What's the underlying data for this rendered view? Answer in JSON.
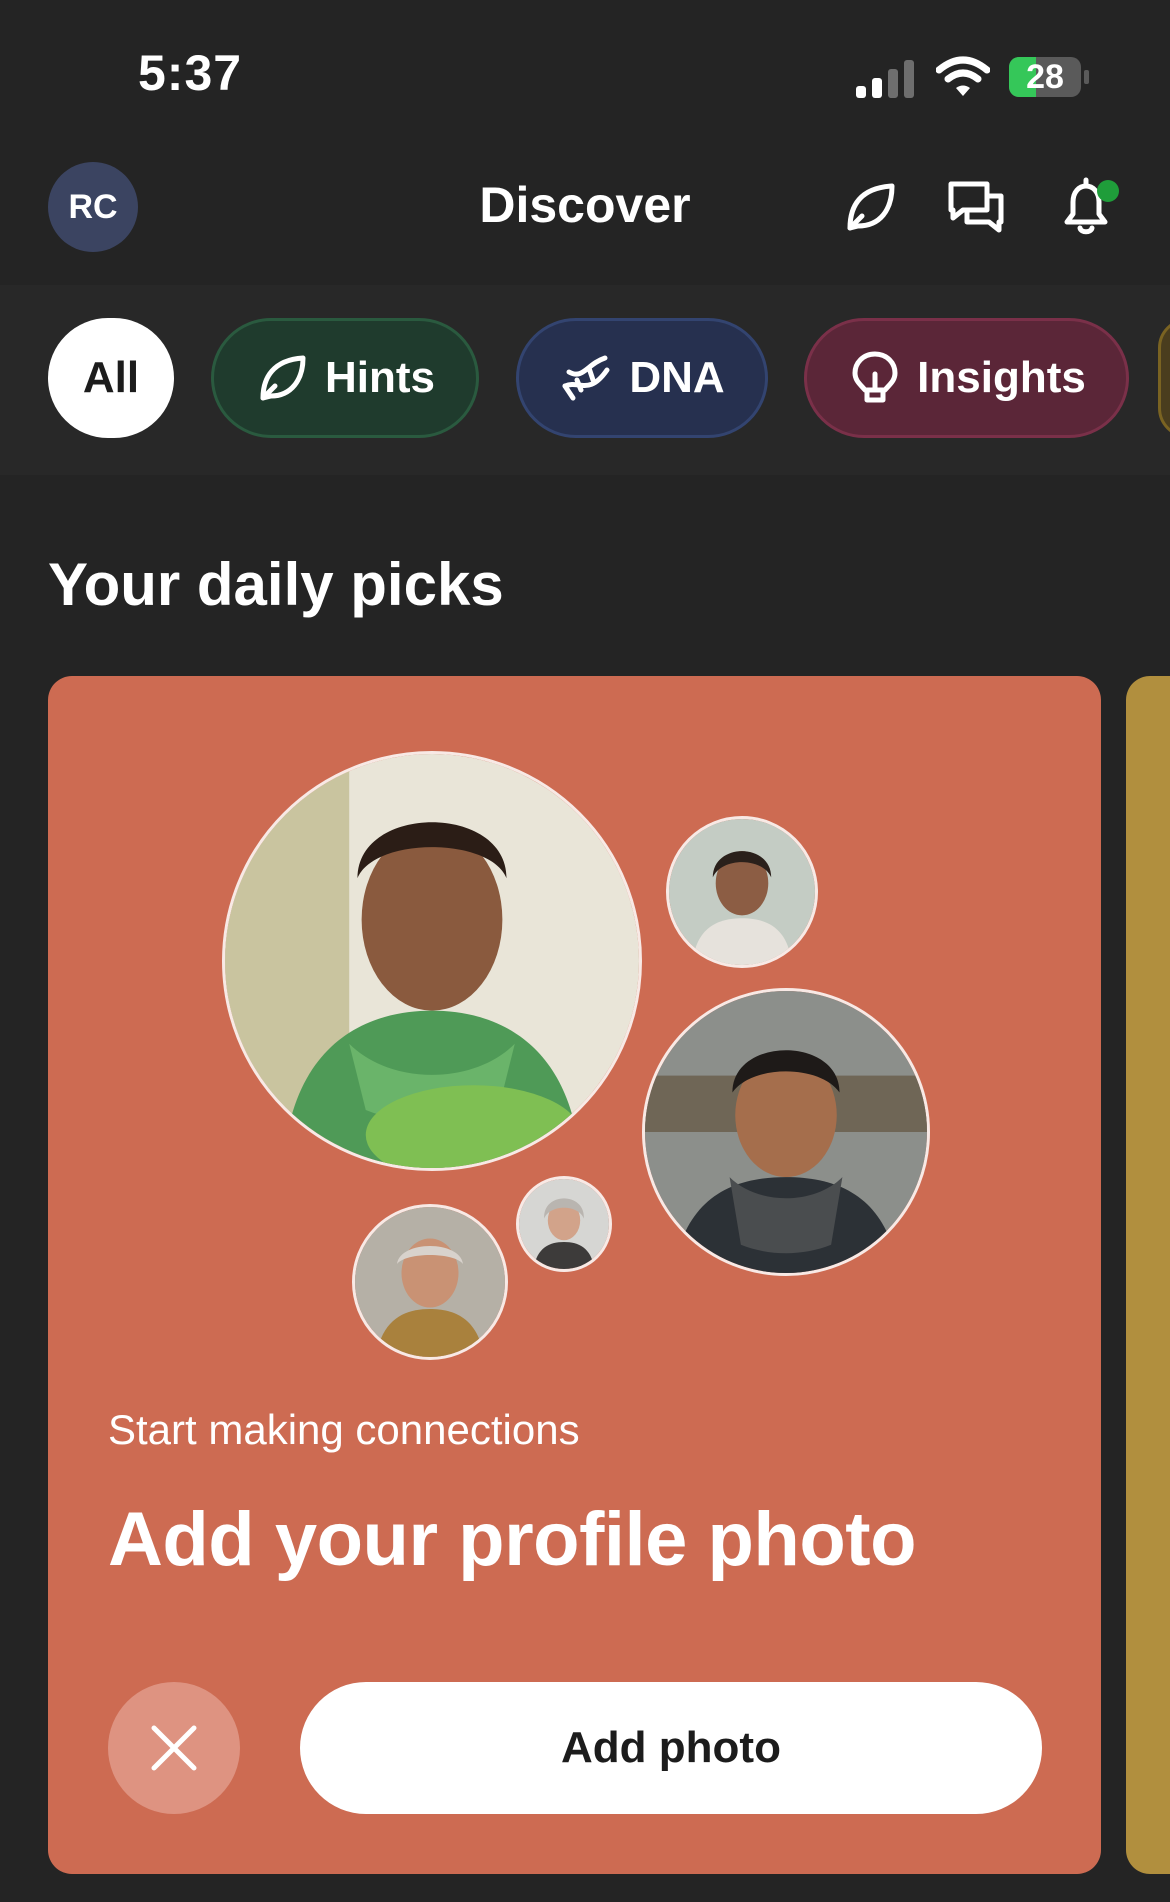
{
  "status_bar": {
    "time": "5:37",
    "battery": "28",
    "icons": [
      "cellular-signal-icon",
      "wifi-icon",
      "battery-charging-icon"
    ]
  },
  "header": {
    "avatar_initials": "RC",
    "title": "Discover",
    "icons": [
      "hint-leaf-icon",
      "messages-icon",
      "bell-icon"
    ],
    "has_unread_notification": true
  },
  "tabs": [
    {
      "label": "All",
      "icon": null,
      "selected": true
    },
    {
      "label": "Hints",
      "icon": "hint-leaf-icon",
      "selected": false
    },
    {
      "label": "DNA",
      "icon": "dna-icon",
      "selected": false
    },
    {
      "label": "Insights",
      "icon": "lightbulb-icon",
      "selected": false
    }
  ],
  "section": {
    "title": "Your daily picks"
  },
  "card": {
    "eyebrow": "Start making connections",
    "title": "Add your profile photo",
    "primary_action": "Add photo",
    "dismiss_icon": "close-icon"
  },
  "colors": {
    "background": "#242424",
    "card": "#cd6b52",
    "hints_tab": "#1f3b2d",
    "dna_tab": "#26304f",
    "insights_tab": "#5b2638",
    "notification_dot": "#1f9d3a"
  }
}
